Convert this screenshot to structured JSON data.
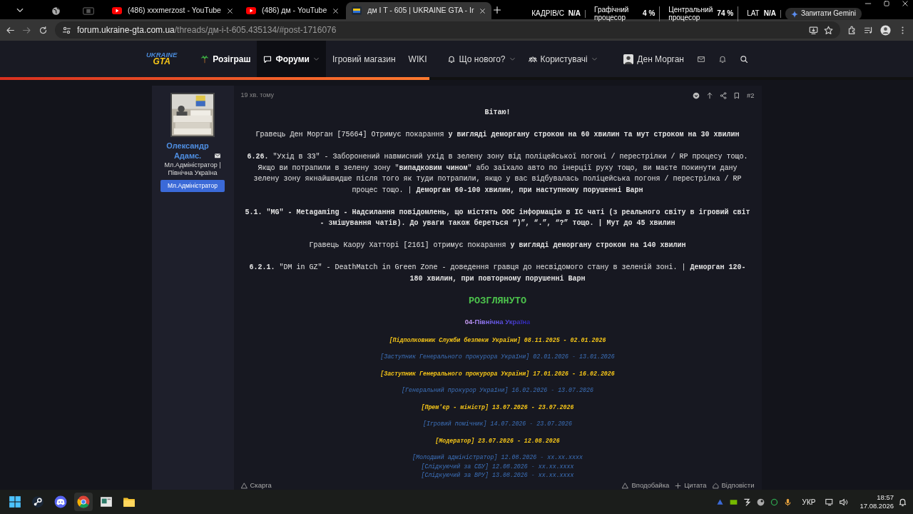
{
  "browser": {
    "tabs": [
      {
        "kind": "globe",
        "selected": false
      },
      {
        "kind": "blank",
        "selected": false
      },
      {
        "kind": "youtube",
        "title": "(486) xxxmerzost - YouTube",
        "selected": false
      },
      {
        "kind": "youtube",
        "title": "(486) дм - YouTube",
        "selected": false
      },
      {
        "kind": "site",
        "title": "дм I T - 605 | UKRAINE GTA - Ir",
        "selected": true
      }
    ],
    "address_host": "forum.ukraine-gta.com.ua",
    "address_path": "/threads/дм-i-t-605.435134/#post-1716076",
    "gemini": "Запитати Gemini"
  },
  "perf_overlay": [
    {
      "label": "КАДРІВ/С",
      "value": "N/A"
    },
    {
      "label": "Графічний процесор",
      "value": "4 %"
    },
    {
      "label": "Центральний процесор",
      "value": "74 %"
    },
    {
      "label": "LAT",
      "value": "N/A"
    }
  ],
  "header": {
    "logo": [
      "UKRAINE",
      "GTA"
    ],
    "nav": [
      {
        "label": "Розіграш",
        "featured": true,
        "selected": false,
        "dropdown": false
      },
      {
        "label": "Форуми",
        "featured": true,
        "selected": true,
        "dropdown": true
      },
      {
        "label": "Ігровий магазин",
        "featured": false,
        "selected": false,
        "dropdown": false
      },
      {
        "label": "WIKI",
        "featured": false,
        "selected": false,
        "dropdown": false
      },
      {
        "label": "Що нового?",
        "featured": false,
        "selected": false,
        "dropdown": true
      },
      {
        "label": "Користувачі",
        "featured": false,
        "selected": false,
        "dropdown": true
      }
    ],
    "user": "Ден Морган",
    "progress": {
      "level": 0.47
    }
  },
  "post": {
    "author": {
      "name": "Олександр Адамс.",
      "title": "Мл.Адміністратор | Північна Україна",
      "badge": "Мл.Адміністратор"
    },
    "time": "19 хв. тому",
    "number": "#2",
    "paragraphs": [
      {
        "text": "Вітаю!",
        "bold": true
      },
      {
        "text": "Гравець Ден Морган [75664] Отримує покарання **у вигляді деморгану строком на 60 хвилин та мут строком на 30 хвилин**",
        "bold": false
      },
      {
        "text": "**6.26.** \"Ухід в ЗЗ\" - Заборонений навмисний ухід в зелену зону від поліцейської погоні / перестрілки / RP процесу тощо. Якщо ви потрапили в зелену зону \"**випадковим чином**\" або заїхало авто по інерції руху тощо, ви маєте покинути дану зелену зону якнайшвидше після того як туди потрапили, якщо у вас відбувалась поліцейська погоня / перестрілка / RP процес тощо. | **Деморган 60-100 хвилин, при наступному порушенні Варн**",
        "bold": false
      },
      {
        "text": "5.1. \"MG\" - Metagaming - Надсилання повідомлень, що містять OOC інформацію в IC чаті (з реального світу в ігровий світ - змішування чатів). До уваги також береться “)”, “.”, “?” тощо. | Мут до 45 хвилин",
        "bold": true
      },
      {
        "text": "Гравець Каору Хатторі [2161] отримує покарання **у вигляді деморгану строком на 140 хвилин**",
        "bold": false
      },
      {
        "text": "**6.2.1.** \"DM in GZ\" - DeathMatch in Green Zone - доведення гравця до несвідомого стану в зеленій зоні. | **Деморган 120-180 хвилин, при повторному порушенні Варн**",
        "bold": false
      }
    ],
    "verdict": "РОЗГЛЯНУТО",
    "signature": {
      "region": "04-Північна Україна",
      "history": [
        [
          {
            "text": "[Підполковник Служби безпеки України] 08.11.2025 - 02.01.2026",
            "kind": "admin"
          }
        ],
        [
          {
            "text": "[Заступник Генерального прокурора України] 02.01.2026 - 13.01.2026",
            "kind": "leader"
          }
        ],
        [
          {
            "text": "[Заступник Генерального прокурора України] 17.01.2026 - 16.02.2026",
            "kind": "admin"
          }
        ],
        [
          {
            "text": "[Генеральний прокурор України] 16.02.2026 - 13.07.2026",
            "kind": "leader"
          }
        ],
        [
          {
            "text": "[Прем'єр - міністр] 13.07.2026 - 23.07.2026",
            "kind": "admin"
          }
        ],
        [
          {
            "text": "[Ігровий помічник] 14.07.2026 - 23.07.2026",
            "kind": "leader"
          }
        ],
        [
          {
            "text": "[Модератор] 23.07.2026 - 12.08.2026",
            "kind": "admin"
          }
        ],
        [
          {
            "text": "[Молодший адміністратор] 12.08.2026 - xx.xx.xxxx",
            "kind": "leader"
          },
          {
            "text": "[Слідкуючий за СБУ] 12.08.2026 - xx.xx.xxxx",
            "kind": "leader"
          },
          {
            "text": "[Слідкуючий за ВРУ] 13.08.2026 - xx.xx.xxxx",
            "kind": "leader"
          }
        ]
      ]
    },
    "actions_left": [
      "Скарга"
    ],
    "actions_right": [
      "Вподобайка",
      "Цитата",
      "Відповісти"
    ]
  },
  "taskbar": {
    "language": "УКР",
    "time": "18:57",
    "date": "17.08.2026"
  }
}
